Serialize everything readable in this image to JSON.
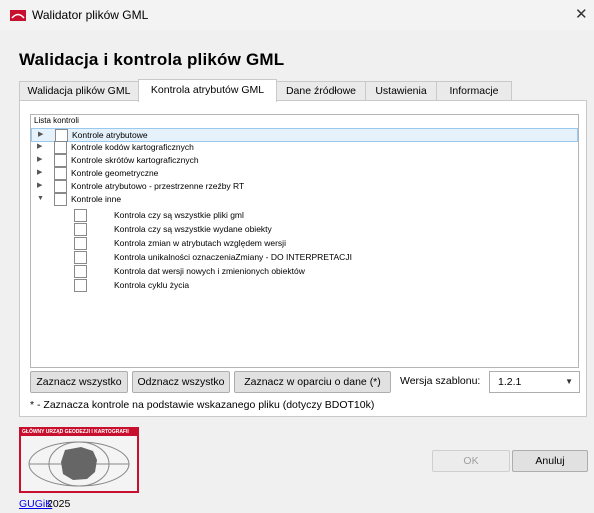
{
  "window": {
    "title": "Walidator plików GML",
    "close_glyph": "✕"
  },
  "heading": "Walidacja i kontrola plików GML",
  "tabs": [
    {
      "label": "Walidacja plików GML"
    },
    {
      "label": "Kontrola atrybutów GML",
      "active": true
    },
    {
      "label": "Dane źródłowe"
    },
    {
      "label": "Ustawienia"
    },
    {
      "label": "Informacje"
    }
  ],
  "tree": {
    "header": "Lista kontroli",
    "nodes": [
      {
        "label": "Kontrole atrybutowe",
        "expanded": false,
        "checked": false,
        "selected": true
      },
      {
        "label": "Kontrole kodów kartograficznych",
        "expanded": false,
        "checked": false
      },
      {
        "label": "Kontrole skrótów kartograficznych",
        "expanded": false,
        "checked": false
      },
      {
        "label": "Kontrole geometryczne",
        "expanded": false,
        "checked": false
      },
      {
        "label": "Kontrole atrybutowo - przestrzenne rzeźby RT",
        "expanded": false,
        "checked": false
      },
      {
        "label": "Kontrole inne",
        "expanded": true,
        "checked": false
      }
    ],
    "children": [
      {
        "label": "Kontrola czy są wszystkie pliki gml",
        "checked": false
      },
      {
        "label": "Kontrola czy są wszystkie wydane obiekty",
        "checked": false
      },
      {
        "label": "Kontrola zmian w atrybutach względem wersji",
        "checked": false
      },
      {
        "label": "Kontrola unikalności oznaczeniaZmiany - DO INTERPRETACJI",
        "checked": false
      },
      {
        "label": "Kontrola dat wersji nowych i zmienionych obiektów",
        "checked": false
      },
      {
        "label": "Kontrola cyklu życia",
        "checked": false
      }
    ]
  },
  "buttons": {
    "select_all": "Zaznacz wszystko",
    "deselect_all": "Odznacz wszystko",
    "select_by_data": "Zaznacz w oparciu o dane (*)",
    "ok": "OK",
    "cancel": "Anuluj"
  },
  "template_version": {
    "label": "Wersja szablonu:",
    "value": "1.2.1"
  },
  "note": "* - Zaznacza kontrole na podstawie wskazanego pliku (dotyczy BDOT10k)",
  "logo": {
    "text": "GŁÓWNY URZĄD GEODEZJI I KARTOGRAFII"
  },
  "footer": {
    "link": "GUGiK",
    "year": "2025"
  },
  "colors": {
    "logo_red": "#c8102e",
    "selection": "#e5f1fb"
  },
  "icons": {
    "app": "gugik-logo-icon",
    "expand": "triangle-right-icon",
    "collapse": "triangle-down-icon"
  }
}
